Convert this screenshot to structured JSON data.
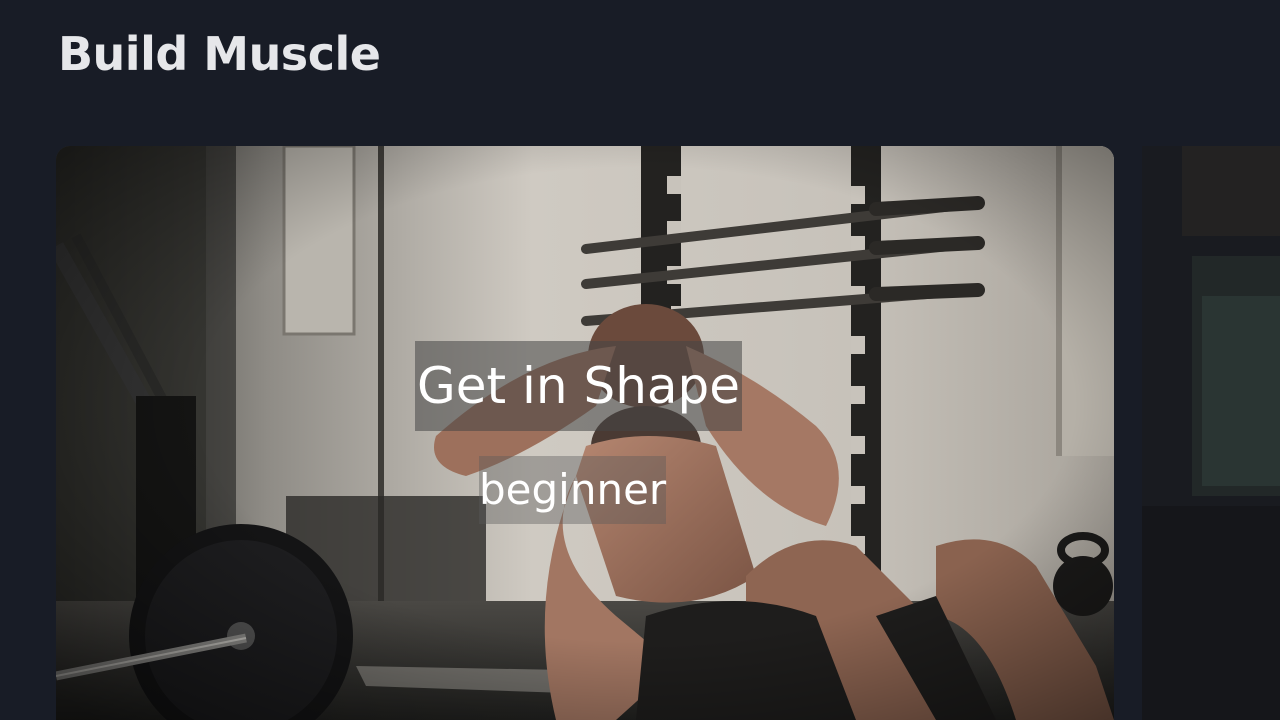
{
  "section": {
    "title": "Build Muscle"
  },
  "cards": [
    {
      "title": "Get in Shape",
      "level": "beginner",
      "image": "gym-workout-photo"
    }
  ],
  "next_card": {
    "image": "dark-gym-photo"
  }
}
